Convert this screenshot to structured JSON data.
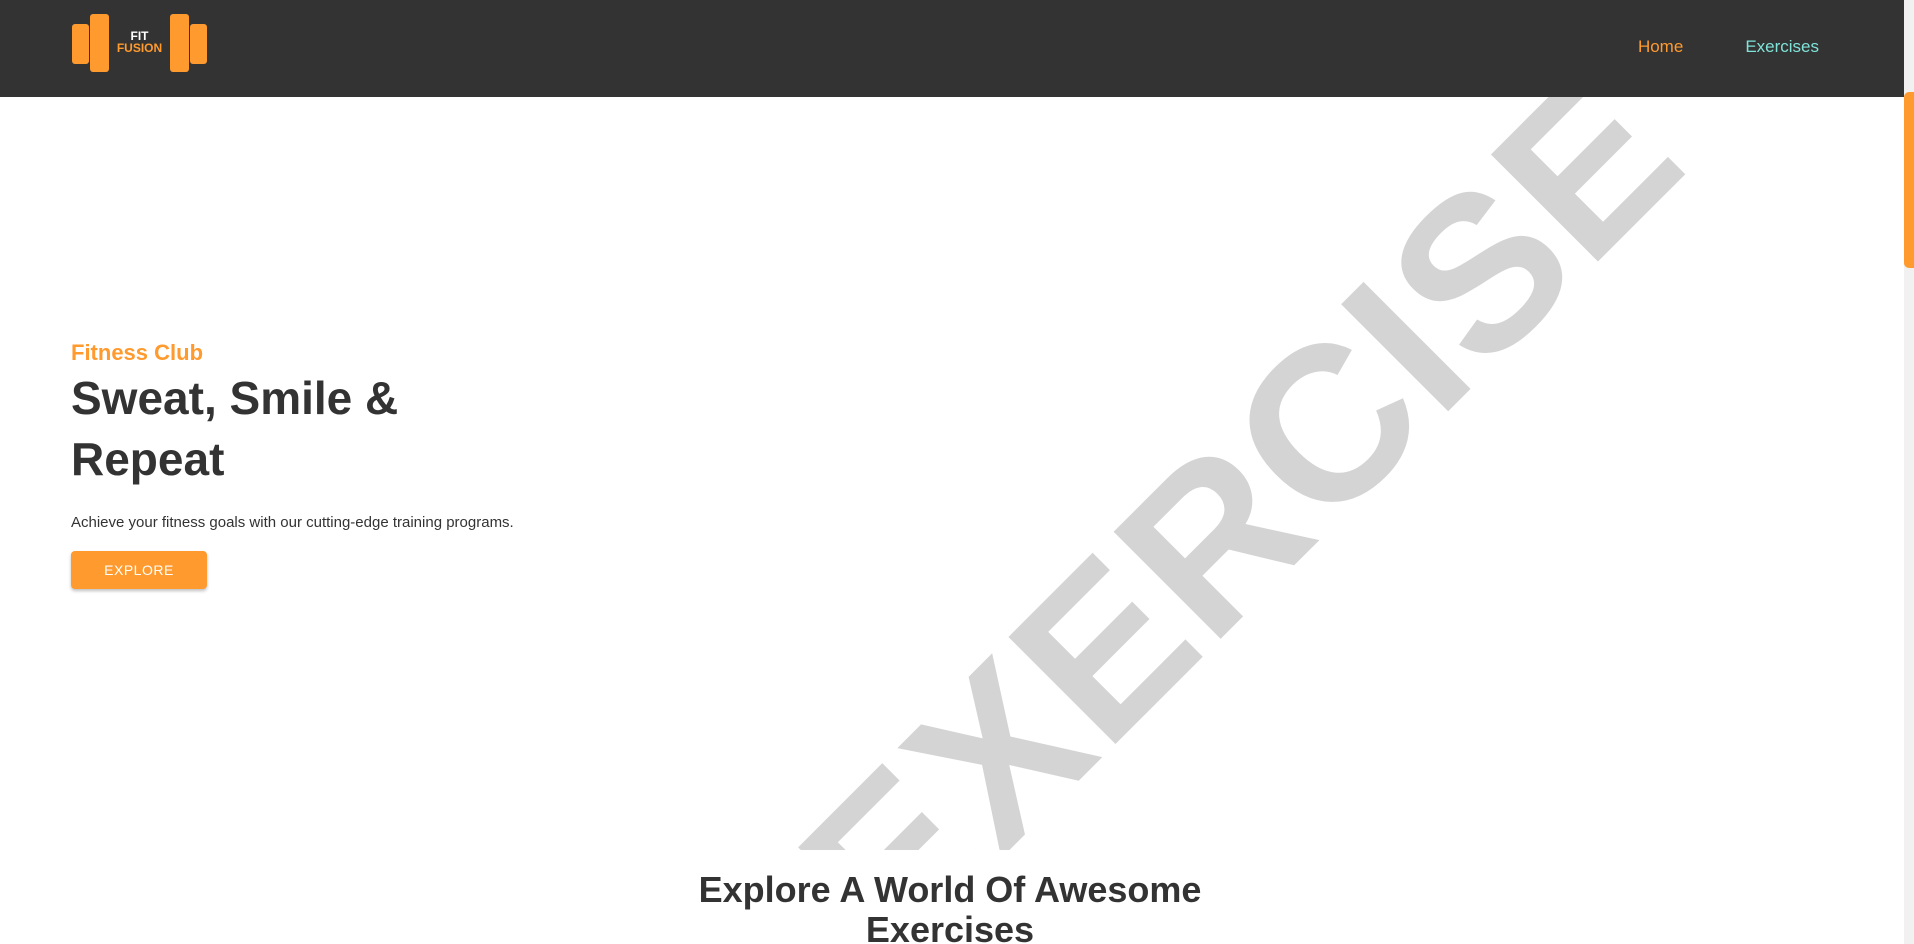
{
  "navbar": {
    "logo": {
      "line1": "FIT",
      "line2": "FUSION"
    },
    "links": [
      {
        "label": "Home",
        "active": true
      },
      {
        "label": "Exercises",
        "active": false
      }
    ]
  },
  "hero": {
    "subtitle": "Fitness Club",
    "title": "Sweat, Smile & Repeat",
    "description": "Achieve your fitness goals with our cutting-edge training programs.",
    "button_label": "EXPLORE",
    "watermark": "EXERCISE"
  },
  "exercises_section": {
    "title": "Explore A World Of Awesome Exercises"
  },
  "colors": {
    "accent": "#ff9a2e",
    "nav_bg": "#333333",
    "nav_link_secondary": "#7fe3d8",
    "text": "#333333",
    "watermark": "#d4d4d4"
  },
  "icons": {
    "logo": "dumbbell-logo-icon"
  }
}
